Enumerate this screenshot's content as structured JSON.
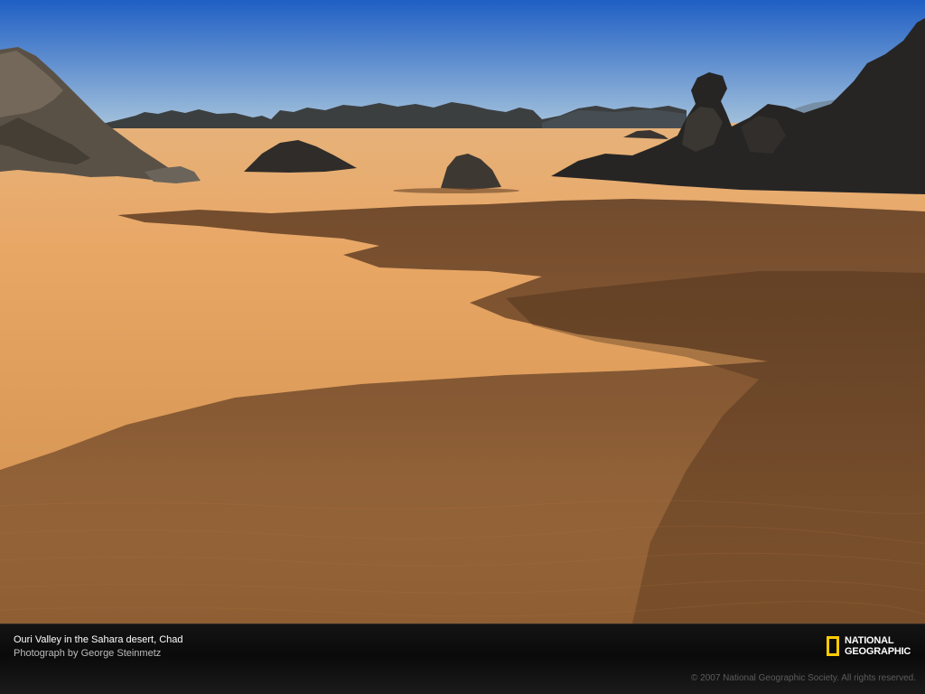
{
  "caption": {
    "title": "Ouri Valley in the Sahara desert, Chad",
    "credit": "Photograph by George Steinmetz"
  },
  "branding": {
    "logo_line1": "NATIONAL",
    "logo_line2": "GEOGRAPHIC",
    "logo_color": "#ffcc00",
    "copyright": "© 2007 National Geographic Society. All rights reserved."
  },
  "colors": {
    "sky_top": "#1f5fc4",
    "sky_bottom": "#a9c6dc",
    "sand_light": "#e8ad6e",
    "sand_mid": "#d2914f",
    "sand_shadow": "#6e4526",
    "rock": "#3a3530",
    "caption_bg": "#0d0d0d"
  }
}
